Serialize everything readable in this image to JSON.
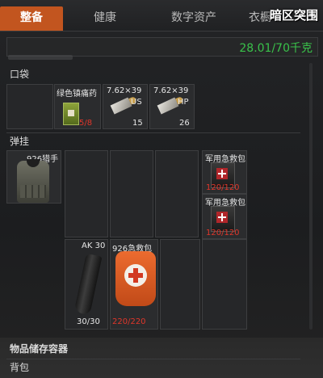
{
  "tabs": [
    {
      "label": "整备",
      "active": true
    },
    {
      "label": "健康",
      "active": false
    },
    {
      "label": "数字资产",
      "active": false
    },
    {
      "label": "衣橱",
      "active": false
    }
  ],
  "logo": "暗区突围",
  "weight": "28.01/70千克",
  "pockets": {
    "title": "口袋",
    "items": [
      {
        "name": "绿色镇痛药",
        "count": "5/8",
        "icon": "green-medicine-box-icon"
      },
      {
        "name": "7.62×39",
        "tag": "US",
        "count": "15",
        "icon": "ammo-icon"
      },
      {
        "name": "7.62×39",
        "tag": "HP",
        "count": "26",
        "icon": "ammo-icon"
      }
    ]
  },
  "rig": {
    "title": "弹挂",
    "vest": {
      "name": "926猎手",
      "icon": "tactical-vest-icon"
    },
    "items": [
      {
        "name": "军用急救包",
        "count": "120/120",
        "icon": "military-first-aid-kit-icon"
      },
      {
        "name": "军用急救包",
        "count": "120/120",
        "icon": "military-first-aid-kit-icon"
      },
      {
        "name": "AK 30",
        "count": "30/30",
        "icon": "magazine-icon"
      },
      {
        "name": "926急救包",
        "count": "220/220",
        "icon": "orange-first-aid-bag-icon"
      }
    ]
  },
  "storage": {
    "title": "物品储存容器"
  },
  "backpack": {
    "title": "背包"
  },
  "colors": {
    "accent": "#c2551f",
    "weight": "#39c24a",
    "durability": "#e0362a"
  }
}
